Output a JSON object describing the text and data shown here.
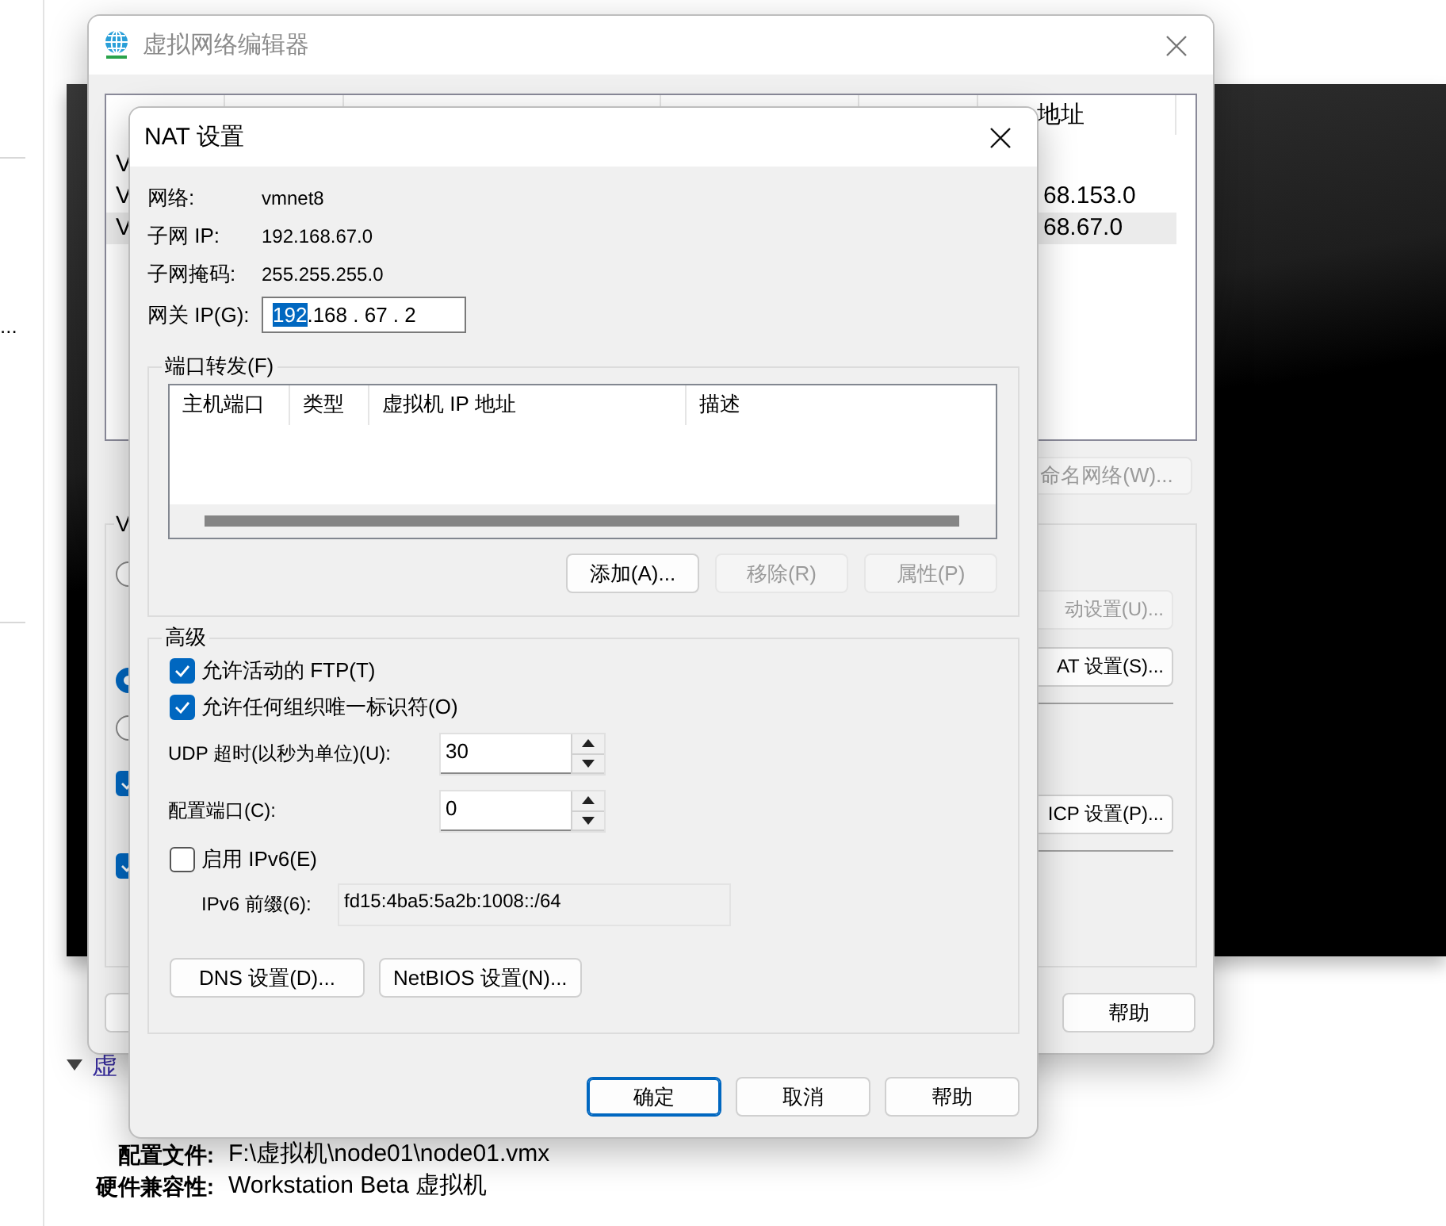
{
  "background_app": {
    "sidebar_more": "...",
    "section": {
      "title": "虚",
      "expanded": true
    },
    "details": [
      {
        "label": "配置文件:",
        "value": "F:\\虚拟机\\node01\\node01.vmx"
      },
      {
        "label": "硬件兼容性:",
        "value": "Workstation Beta 虚拟机"
      }
    ]
  },
  "editor_window": {
    "title": "虚拟网络编辑器",
    "subnet_header": "地址",
    "rows": [
      {
        "name": "V",
        "selected": false
      },
      {
        "name": "V",
        "subnet": "68.153.0",
        "selected": false
      },
      {
        "name": "V",
        "subnet": "68.67.0",
        "selected": true
      }
    ],
    "rename_button": {
      "label": "命名网络(W)...",
      "disabled": true
    },
    "group_label": "V",
    "group_controls": [
      {
        "kind": "radio",
        "checked": false
      },
      {
        "kind": "radio",
        "checked": true
      },
      {
        "kind": "radio",
        "checked": false
      },
      {
        "kind": "checkbox",
        "checked": true
      },
      {
        "kind": "checkbox",
        "checked": true
      }
    ],
    "group_buttons": [
      {
        "label": "动设置(U)...",
        "disabled": true
      },
      {
        "label": "AT 设置(S)...",
        "disabled": false
      },
      {
        "label": "ICP 设置(P)...",
        "disabled": false
      }
    ],
    "help_button": "帮助"
  },
  "nat_dialog": {
    "title": "NAT 设置",
    "info": [
      {
        "label": "网络:",
        "value": "vmnet8"
      },
      {
        "label": "子网 IP:",
        "value": "192.168.67.0"
      },
      {
        "label": "子网掩码:",
        "value": "255.255.255.0"
      }
    ],
    "gateway": {
      "label": "网关 IP(G):",
      "segments": [
        {
          "text": "192",
          "selected": true
        },
        {
          "text": ".168 . 67 . 2",
          "selected": false
        }
      ]
    },
    "port_forwarding": {
      "title": "端口转发(F)",
      "columns": [
        "主机端口",
        "类型",
        "虚拟机 IP 地址",
        "描述"
      ],
      "buttons": [
        {
          "label": "添加(A)...",
          "disabled": false
        },
        {
          "label": "移除(R)",
          "disabled": true
        },
        {
          "label": "属性(P)",
          "disabled": true
        }
      ]
    },
    "advanced": {
      "title": "高级",
      "options": [
        {
          "label": "允许活动的 FTP(T)",
          "checked": true
        },
        {
          "label": "允许任何组织唯一标识符(O)",
          "checked": true
        }
      ],
      "udp_timeout": {
        "label": "UDP 超时(以秒为单位)(U):",
        "value": "30"
      },
      "config_port": {
        "label": "配置端口(C):",
        "value": "0"
      },
      "ipv6": {
        "label": "启用 IPv6(E)",
        "checked": false
      },
      "ipv6_prefix": {
        "label": "IPv6 前缀(6):",
        "value": "fd15:4ba5:5a2b:1008::/64",
        "disabled": true
      },
      "buttons": [
        "DNS 设置(D)...",
        "NetBIOS 设置(N)..."
      ]
    },
    "footer_buttons": [
      {
        "label": "确定",
        "default": true
      },
      {
        "label": "取消",
        "default": false
      },
      {
        "label": "帮助",
        "default": false
      }
    ]
  }
}
